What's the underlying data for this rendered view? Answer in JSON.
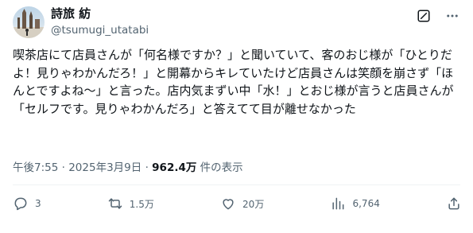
{
  "author": {
    "display_name": "詩旅 紡",
    "handle": "@tsumugi_utatabi",
    "avatar_icon": "avatar-photo-icon"
  },
  "header": {
    "grok_icon": "grok-icon",
    "more_icon": "more-options-icon"
  },
  "post": {
    "text": "喫茶店にて店員さんが「何名様ですか？」と聞いていて、客のおじ様が「ひとりだよ！見りゃわかんだろ！」と開幕からキレていたけど店員さんは笑顔を崩さず「ほんとですよね〜」と言った。店内気まずい中「水！」とおじ様が言うと店員さんが「セルフです。見りゃわかんだろ」と答えてて目が離せなかった"
  },
  "meta": {
    "time": "午後7:55",
    "separator": "·",
    "date": "2025年3月9日",
    "views_count": "962.4万",
    "views_label": " 件の表示"
  },
  "actions": {
    "reply": {
      "icon": "reply-icon",
      "count": "3"
    },
    "repost": {
      "icon": "repost-icon",
      "count": "1.5万"
    },
    "like": {
      "icon": "like-icon",
      "count": "20万"
    },
    "views": {
      "icon": "views-icon",
      "count": "6,764"
    },
    "share": {
      "icon": "share-icon"
    }
  },
  "colors": {
    "text_primary": "#0f1419",
    "text_secondary": "#536471",
    "divider": "#eff3f4"
  }
}
